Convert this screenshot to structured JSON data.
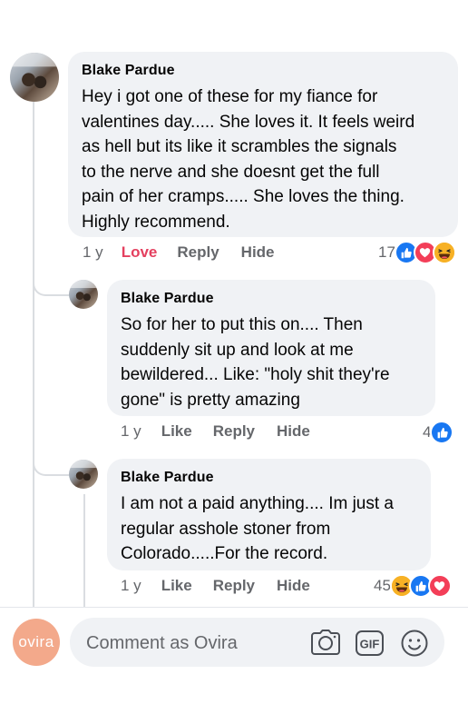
{
  "comments": [
    {
      "author": "Blake Pardue",
      "lines": [
        "Hey i got one of these for my fiance for",
        "valentines day..... She loves it. It feels weird",
        "as hell but its like it scrambles the signals",
        "to the nerve and she doesnt get the full",
        "pain of her cramps..... She loves the thing.",
        "Highly recommend."
      ],
      "age": "1 y",
      "reaction_label": "Love",
      "reply_label": "Reply",
      "hide_label": "Hide",
      "reaction_count": "17",
      "reactions": [
        "like",
        "love",
        "haha"
      ]
    }
  ],
  "replies": [
    {
      "author": "Blake Pardue",
      "lines": [
        "So for her to put this on.... Then",
        "suddenly sit up and look at me",
        "bewildered... Like: \"holy shit they're",
        "gone\" is pretty amazing"
      ],
      "age": "1 y",
      "like_label": "Like",
      "reply_label": "Reply",
      "hide_label": "Hide",
      "reaction_count": "4",
      "reactions": [
        "like"
      ]
    },
    {
      "author": "Blake Pardue",
      "lines": [
        "I am not a paid anything.... Im just a",
        "regular asshole stoner from",
        "Colorado.....For the record."
      ],
      "age": "1 y",
      "like_label": "Like",
      "reply_label": "Reply",
      "hide_label": "Hide",
      "reaction_count": "45",
      "reactions": [
        "haha",
        "like",
        "love"
      ]
    }
  ],
  "composer": {
    "brand_avatar_text": "ovira",
    "placeholder": "Comment as Ovira",
    "icons": [
      "camera-icon",
      "gif-icon",
      "emoji-icon"
    ],
    "gif_text": "GIF"
  },
  "colors": {
    "love_action": "#e4405f",
    "like_blue": "#1877f2",
    "love_red": "#f33e58",
    "haha_yellow": "#f7b125",
    "bubble_bg": "#f0f2f5",
    "brand_avatar": "#f3a98b"
  }
}
